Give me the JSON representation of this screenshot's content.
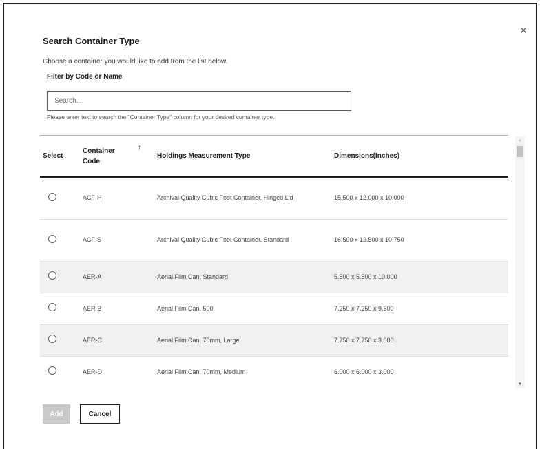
{
  "dialog": {
    "title": "Search Container Type",
    "description": "Choose a container you would like to add from the list below.",
    "close_icon": "×",
    "filter_label": "Filter by Code or Name",
    "search": {
      "placeholder": "Search...",
      "value": ""
    },
    "helper_text": "Please enter text to search the \"Container Type\" column for your desired container type."
  },
  "table": {
    "headers": {
      "select": "Select",
      "code": "Container Code",
      "sort_icon": "↑",
      "measurement": "Holdings Measurement Type",
      "dimensions": "Dimensions(Inches)"
    },
    "rows": [
      {
        "code": "ACF-H",
        "measurement": "Archival Quality Cubic Foot Container, Hinged Lid",
        "dimensions": "15.500 x 12.000 x 10.000"
      },
      {
        "code": "ACF-S",
        "measurement": "Archival Quality Cubic Foot Container, Standard",
        "dimensions": "16.500 x 12.500 x 10.750"
      },
      {
        "code": "AER-A",
        "measurement": "Aerial Film Can, Standard",
        "dimensions": "5.500 x 5.500 x 10.000"
      },
      {
        "code": "AER-B",
        "measurement": "Aerial Film Can, 500",
        "dimensions": "7.250 x 7.250 x 9.500"
      },
      {
        "code": "AER-C",
        "measurement": "Aerial Film Can, 70mm, Large",
        "dimensions": "7.750 x 7.750 x 3.000"
      },
      {
        "code": "AER-D",
        "measurement": "Aerial Film Can, 70mm, Medium",
        "dimensions": "6.000 x 6.000 x 3.000"
      }
    ]
  },
  "scrollbar": {
    "up_icon": "▲",
    "down_icon": "▼"
  },
  "footer": {
    "add_label": "Add",
    "cancel_label": "Cancel"
  }
}
